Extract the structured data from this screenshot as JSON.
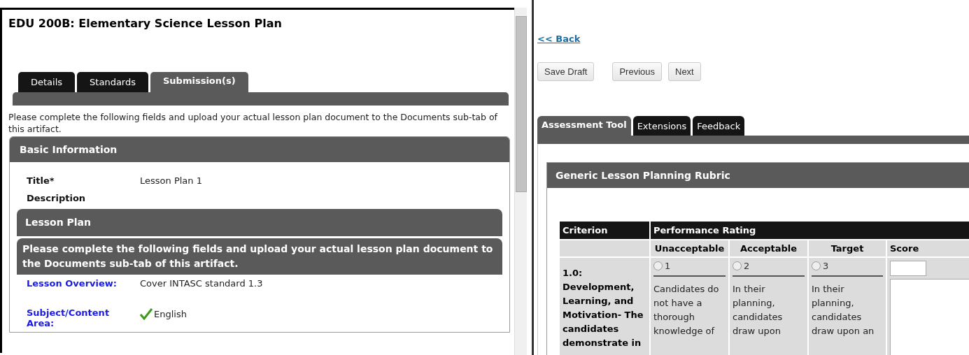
{
  "left_panel": {
    "title": "EDU 200B: Elementary Science Lesson Plan",
    "tabs": [
      {
        "label": "Details",
        "selected": false
      },
      {
        "label": "Standards",
        "selected": false
      },
      {
        "label": "Submission(s)",
        "selected": true
      }
    ],
    "intro": "Please complete the following fields and upload your actual lesson plan document to the Documents sub-tab of this artifact.",
    "basic_information": {
      "heading": "Basic Information",
      "fields": [
        {
          "label": "Title*",
          "value": "Lesson Plan 1"
        },
        {
          "label": "Description"
        }
      ]
    },
    "lesson_plan": {
      "heading": "Lesson Plan",
      "instruction": "Please complete the following fields and upload your actual lesson plan document to the Documents sub-tab of this artifact.",
      "fields": [
        {
          "label": "Lesson Overview:",
          "options": [
            {
              "text": "Cover INTASC standard 1.3",
              "checked": false
            }
          ]
        },
        {
          "label": "Subject/Content Area:",
          "options": [
            {
              "text": "English",
              "checked": true
            }
          ]
        }
      ]
    }
  },
  "right_panel": {
    "back_link": "<< Back",
    "buttons": [
      "Save Draft",
      "Previous",
      "Next"
    ],
    "tabs": [
      {
        "label": "Assessment Tool",
        "selected": true
      },
      {
        "label": "Extensions",
        "selected": false
      },
      {
        "label": "Feedback",
        "selected": false
      }
    ],
    "rubric": {
      "heading": "Generic Lesson Planning Rubric",
      "criterion_header": "Criterion",
      "rating_header": "Performance Rating",
      "levels": [
        "Unacceptable",
        "Acceptable",
        "Target"
      ],
      "score_header": "Score",
      "rows": [
        {
          "criterion": "1.0: Development, Learning, and Motivation- The candidates demonstrate in",
          "ratings": [
            {
              "value": "1",
              "selected": false,
              "description": "Candidates do not have a thorough knowledge of"
            },
            {
              "value": "2",
              "selected": false,
              "description": "In their planning, candidates draw upon"
            },
            {
              "value": "3",
              "selected": false,
              "description": "In their planning, candidates draw upon an"
            }
          ]
        }
      ]
    }
  }
}
